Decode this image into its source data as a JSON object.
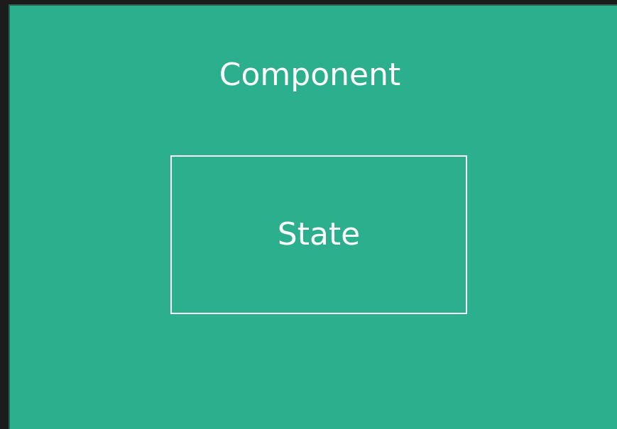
{
  "diagram": {
    "outer": {
      "label": "Component",
      "fill_color": "#2baf8c"
    },
    "inner": {
      "label": "State",
      "border_color": "#ffffff"
    },
    "text_color": "#ffffff",
    "background_color": "#1c1c1c"
  }
}
